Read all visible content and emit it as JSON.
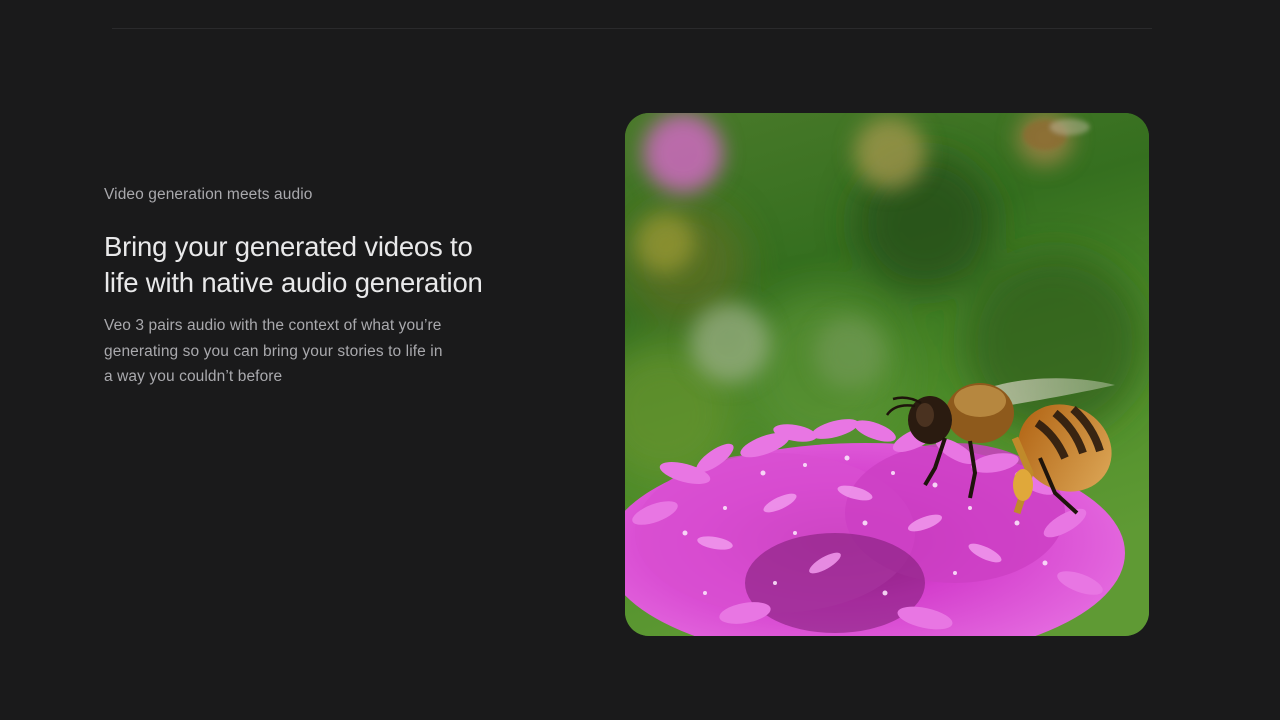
{
  "section": {
    "eyebrow": "Video generation meets audio",
    "headline": "Bring your generated videos to life with native audio generation",
    "body": "Veo 3 pairs audio with the context of what you’re generating so you can bring your stories to life in a way you couldn’t before"
  },
  "colors": {
    "page_background": "#1a1a1b",
    "heading_text": "#e9e9ea",
    "secondary_text": "#a9a9ad",
    "bokeh_green": "#3b7a26",
    "flower_magenta": "#d93fd0",
    "bee_amber": "#c07a1e"
  },
  "media": {
    "icon": "bee-on-flower-image"
  }
}
